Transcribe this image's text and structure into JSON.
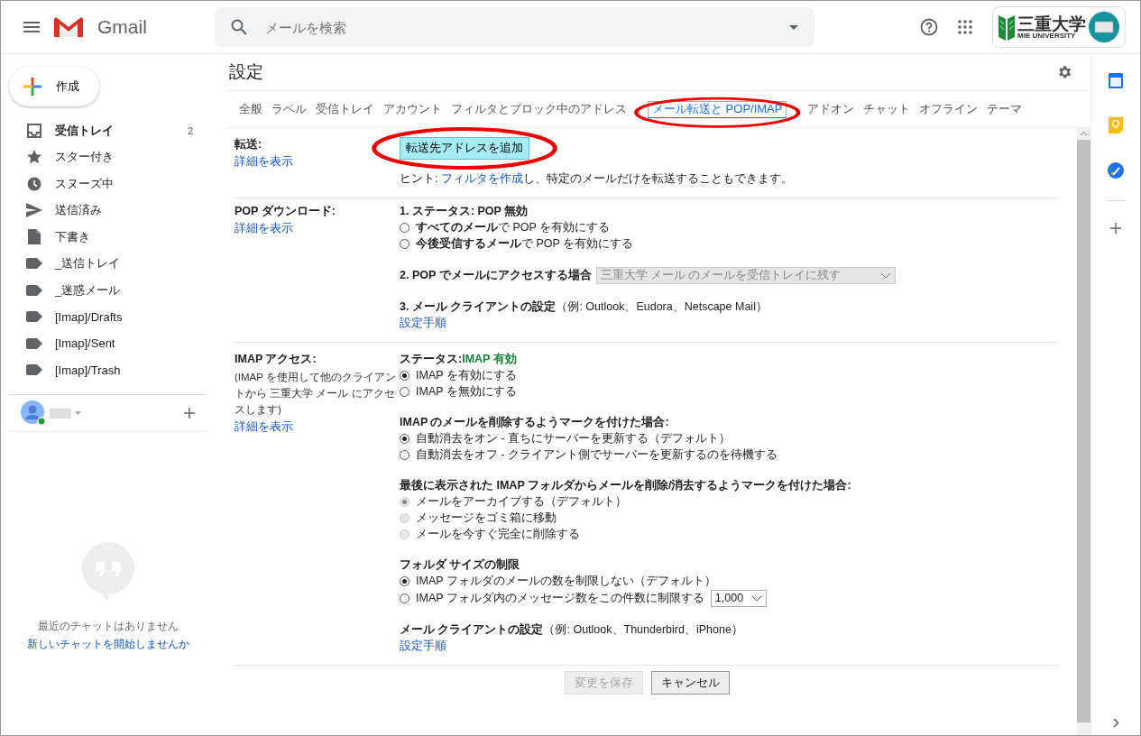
{
  "header": {
    "product": "Gmail",
    "search": {
      "placeholder": "メールを検索"
    },
    "account": {
      "logo_text": "三重大学",
      "logo_subtext": "MIE UNIVERSITY"
    }
  },
  "sidebar": {
    "compose": "作成",
    "items": [
      {
        "kind": "inbox",
        "label": "受信トレイ",
        "count": "2",
        "unread": true
      },
      {
        "kind": "star",
        "label": "スター付き",
        "unread": false
      },
      {
        "kind": "clock",
        "label": "スヌーズ中",
        "unread": false
      },
      {
        "kind": "send",
        "label": "送信済み",
        "unread": false
      },
      {
        "kind": "draft",
        "label": "下書き",
        "unread": false
      },
      {
        "kind": "label",
        "label": "_送信トレイ",
        "unread": false
      },
      {
        "kind": "label",
        "label": "_迷惑メール",
        "unread": false
      },
      {
        "kind": "label",
        "label": "[Imap]/Drafts",
        "unread": false
      },
      {
        "kind": "label",
        "label": "[Imap]/Sent",
        "unread": false
      },
      {
        "kind": "label",
        "label": "[Imap]/Trash",
        "unread": false
      }
    ],
    "chat": {
      "online": true,
      "empty_text": "最近のチャットはありません",
      "start_link": "新しいチャットを開始しませんか"
    }
  },
  "settings": {
    "title": "設定",
    "tabs": [
      {
        "label": "全般",
        "selected": false,
        "highlighted": false
      },
      {
        "label": "ラベル",
        "selected": false,
        "highlighted": false
      },
      {
        "label": "受信トレイ",
        "selected": false,
        "highlighted": false
      },
      {
        "label": "アカウント",
        "selected": false,
        "highlighted": false
      },
      {
        "label": "フィルタとブロック中のアドレス",
        "selected": false,
        "highlighted": false
      },
      {
        "label": "メール転送と POP/IMAP",
        "selected": true,
        "highlighted": true
      },
      {
        "label": "アドオン",
        "selected": false,
        "highlighted": false
      },
      {
        "label": "チャット",
        "selected": false,
        "highlighted": false
      },
      {
        "label": "オフライン",
        "selected": false,
        "highlighted": false
      },
      {
        "label": "テーマ",
        "selected": false,
        "highlighted": false
      }
    ],
    "sections": [
      {
        "label": "転送:",
        "link": "詳細を表示",
        "groups": [
          {
            "rows": [
              {
                "kind": "button",
                "text": "転送先アドレスを追加",
                "highlighted": true
              }
            ]
          },
          {
            "rows": [
              {
                "kind": "hint",
                "before": "ヒント: ",
                "link": "フィルタを作成",
                "after": "し、特定のメールだけを転送することもできます。"
              }
            ]
          }
        ]
      },
      {
        "label": "POP ダウンロード:",
        "link": "詳細を表示",
        "groups": [
          {
            "rows": [
              {
                "kind": "heading",
                "text": "1. ステータス: POP 無効"
              },
              {
                "kind": "radio",
                "text": "**すべてのメール**で POP を有効にする",
                "selected": false,
                "disabled": false
              },
              {
                "kind": "radio",
                "text": "**今後受信するメール**で POP を有効にする",
                "selected": false,
                "disabled": false
              }
            ]
          },
          {
            "rows": [
              {
                "kind": "select",
                "text": "2. POP でメールにアクセスする場合",
                "value": "三重大学 メール のメールを受信トレイに残す",
                "disabled": true
              }
            ]
          },
          {
            "rows": [
              {
                "kind": "heading",
                "text": "3. メール クライアントの設定",
                "example": "（例: Outlook、Eudora、Netscape Mail）"
              },
              {
                "kind": "link",
                "text": "設定手順"
              }
            ]
          }
        ]
      },
      {
        "label": "IMAP アクセス:",
        "note": "(IMAP を使用して他のクライアントから 三重大学 メール にアクセスします)",
        "link": "詳細を表示",
        "groups": [
          {
            "rows": [
              {
                "kind": "status",
                "text": "ステータス:",
                "value": "IMAP 有効"
              },
              {
                "kind": "radio",
                "text": "IMAP を有効にする",
                "selected": true,
                "disabled": false
              },
              {
                "kind": "radio",
                "text": "IMAP を無効にする",
                "selected": false,
                "disabled": false
              }
            ]
          },
          {
            "rows": [
              {
                "kind": "heading",
                "text": "IMAP のメールを削除するようマークを付けた場合:"
              },
              {
                "kind": "radio",
                "text": "自動消去をオン - 直ちにサーバーを更新する（デフォルト）",
                "selected": true,
                "disabled": false
              },
              {
                "kind": "radio",
                "text": "自動消去をオフ - クライアント側でサーバーを更新するのを待機する",
                "selected": false,
                "disabled": false
              }
            ]
          },
          {
            "rows": [
              {
                "kind": "heading",
                "text": "最後に表示された IMAP フォルダからメールを削除/消去するようマークを付けた場合:"
              },
              {
                "kind": "radio",
                "text": "メールをアーカイブする（デフォルト）",
                "selected": true,
                "disabled": true
              },
              {
                "kind": "radio",
                "text": "メッセージをゴミ箱に移動",
                "selected": false,
                "disabled": true
              },
              {
                "kind": "radio",
                "text": "メールを今すぐ完全に削除する",
                "selected": false,
                "disabled": true
              }
            ]
          },
          {
            "rows": [
              {
                "kind": "heading",
                "text": "フォルダ サイズの制限"
              },
              {
                "kind": "radio",
                "text": "IMAP フォルダのメールの数を制限しない（デフォルト）",
                "selected": true,
                "disabled": false
              },
              {
                "kind": "radio",
                "text": "IMAP フォルダ内のメッセージ数をこの件数に制限する",
                "selected": false,
                "disabled": false,
                "select": "1,000"
              }
            ]
          },
          {
            "rows": [
              {
                "kind": "heading",
                "text": "メール クライアントの設定",
                "example": "（例: Outlook、Thunderbird、iPhone）"
              },
              {
                "kind": "link",
                "text": "設定手順"
              }
            ]
          }
        ]
      }
    ],
    "buttons": [
      {
        "label": "変更を保存",
        "disabled": true
      },
      {
        "label": "キャンセル",
        "disabled": false
      }
    ]
  }
}
